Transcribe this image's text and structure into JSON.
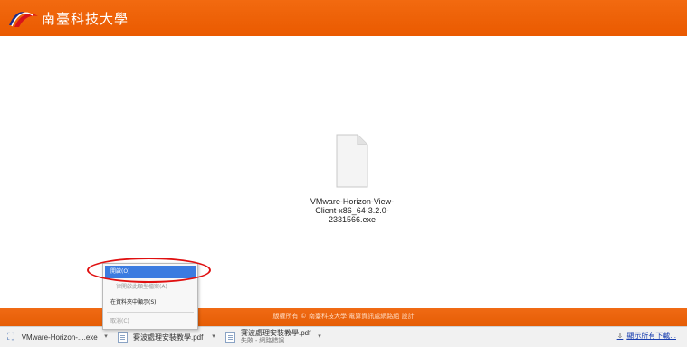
{
  "header": {
    "school_name": "南臺科技大學"
  },
  "file": {
    "name": "VMware-Horizon-View-Client-x86_64-3.2.0-2331566.exe",
    "name_lines": [
      "VMware-Horizon-View-",
      "Client-x86_64-3.2.0-",
      "2331566.exe"
    ]
  },
  "footer": {
    "copyright": "版權所有 © 南臺科技大學 電算資訊處網路組 設計"
  },
  "downloads": [
    {
      "label": "VMware-Horizon-....exe"
    },
    {
      "label": "賽波處理安裝教學.pdf"
    },
    {
      "label": "賽波處理安裝教學.pdf",
      "status": "失敗 - 網路錯誤"
    }
  ],
  "show_all": "顯示所有下載...",
  "context_menu": {
    "items": [
      {
        "label": "開啟(O)",
        "state": "active"
      },
      {
        "label": "一律開啟此類型檔案(A)",
        "state": "disabled"
      },
      {
        "label": "在資料夾中顯示(S)",
        "state": "normal"
      },
      {
        "label": "取消(C)",
        "state": "disabled"
      }
    ]
  },
  "colors": {
    "header_orange": "#ea5a00",
    "highlight_red": "#e01010",
    "menu_active": "#3b7be0"
  }
}
